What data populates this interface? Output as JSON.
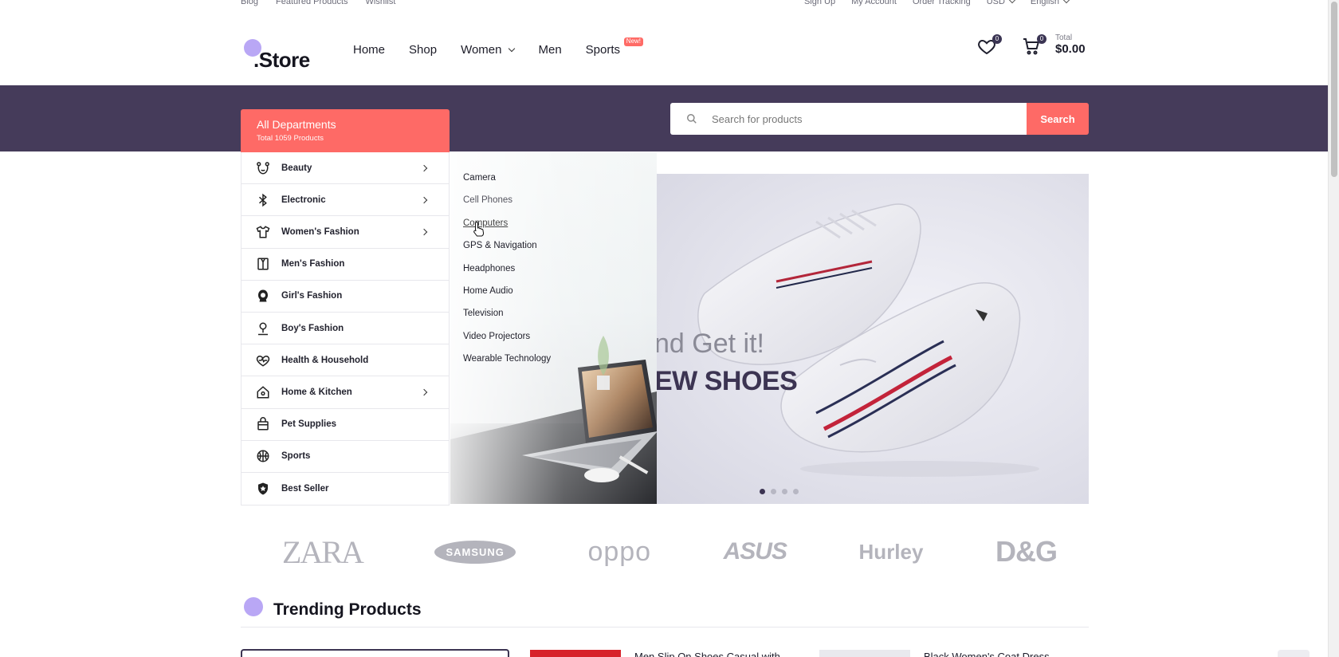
{
  "topbar": {
    "left_links": [
      "Blog",
      "Featured Products",
      "Wishlist"
    ],
    "sign_up": "Sign Up",
    "my_account": "My Account",
    "order_tracking": "Order Tracking",
    "currency": "USD",
    "language": "English"
  },
  "header": {
    "logo_text": ".Store",
    "nav": {
      "home": "Home",
      "shop": "Shop",
      "women": "Women",
      "men": "Men",
      "sports": "Sports",
      "sports_badge": "New!"
    },
    "wishlist_count": "0",
    "cart_count": "0",
    "total_label": "Total",
    "total_amount": "$0.00"
  },
  "departments": {
    "title": "All Departments",
    "subtitle": "Total 1059 Products",
    "items": [
      {
        "label": "Beauty",
        "icon": "bear-face-icon",
        "has_children": true
      },
      {
        "label": "Electronic",
        "icon": "bluetooth-icon",
        "has_children": true
      },
      {
        "label": "Women's Fashion",
        "icon": "tshirt-icon",
        "has_children": true
      },
      {
        "label": "Men's Fashion",
        "icon": "suit-icon",
        "has_children": false
      },
      {
        "label": "Girl's Fashion",
        "icon": "girl-face-icon",
        "has_children": false
      },
      {
        "label": "Boy's Fashion",
        "icon": "person-icon",
        "has_children": false
      },
      {
        "label": "Health & Household",
        "icon": "heartbeat-icon",
        "has_children": false
      },
      {
        "label": "Home & Kitchen",
        "icon": "home-icon",
        "has_children": true
      },
      {
        "label": "Pet Supplies",
        "icon": "bag-icon",
        "has_children": false
      },
      {
        "label": "Sports",
        "icon": "basketball-icon",
        "has_children": false
      },
      {
        "label": "Best Seller",
        "icon": "shield-star-icon",
        "has_children": false
      }
    ]
  },
  "submenu": {
    "items": [
      "Camera",
      "Cell Phones",
      "Computers",
      "GPS & Navigation",
      "Headphones",
      "Home Audio",
      "Television",
      "Video Projectors",
      "Wearable Technology"
    ]
  },
  "search": {
    "placeholder": "Search for products",
    "button": "Search"
  },
  "hero": {
    "subtitle": "nd Get it!",
    "headline": "EW SHOES",
    "slides": 4,
    "active_slide": 1
  },
  "brands": [
    "ZARA",
    "SAMSUNG",
    "oppo",
    "ASUS",
    "Hurley",
    "D&G"
  ],
  "trending": {
    "title": "Trending Products",
    "products": [
      {
        "title": "Men Slip On Shoes Casual with"
      },
      {
        "title": "Black Women's Coat Dress"
      }
    ]
  },
  "colors": {
    "accent": "#fe6a66",
    "band": "#453b5a",
    "logo_dot": "#b9a7f5"
  }
}
